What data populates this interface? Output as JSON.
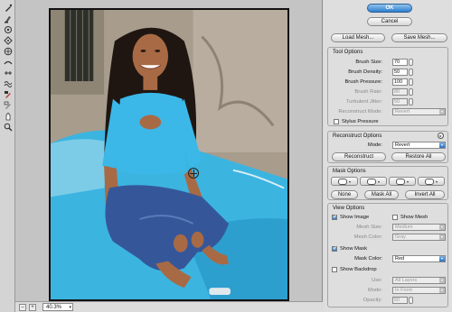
{
  "tools": [
    {
      "name": "forward-warp-icon"
    },
    {
      "name": "reconstruct-icon"
    },
    {
      "name": "twirl-clockwise-icon"
    },
    {
      "name": "pucker-icon"
    },
    {
      "name": "bloat-icon"
    },
    {
      "name": "push-left-icon"
    },
    {
      "name": "mirror-icon"
    },
    {
      "name": "turbulence-icon"
    },
    {
      "name": "freeze-mask-icon"
    },
    {
      "name": "thaw-mask-icon"
    },
    {
      "name": "hand-icon"
    },
    {
      "name": "zoom-icon"
    }
  ],
  "status": {
    "zoom_minus": "–",
    "zoom_plus": "+",
    "zoom": "40.3%"
  },
  "dialog": {
    "ok": "OK",
    "cancel": "Cancel",
    "load_mesh": "Load Mesh...",
    "save_mesh": "Save Mesh..."
  },
  "tool_options": {
    "title": "Tool Options",
    "brush_size": {
      "label": "Brush Size:",
      "value": "70"
    },
    "brush_density": {
      "label": "Brush Density:",
      "value": "50"
    },
    "brush_pressure": {
      "label": "Brush Pressure:",
      "value": "100"
    },
    "brush_rate": {
      "label": "Brush Rate:",
      "value": "80"
    },
    "turbulent_jitter": {
      "label": "Turbulent Jitter:",
      "value": "50"
    },
    "reconstruct_mode": {
      "label": "Reconstruct Mode:",
      "value": "Revert"
    },
    "stylus_pressure": "Stylus Pressure"
  },
  "reconstruct_options": {
    "title": "Reconstruct Options",
    "mode_label": "Mode:",
    "mode_value": "Revert",
    "reconstruct": "Reconstruct",
    "restore_all": "Restore All"
  },
  "mask_options": {
    "title": "Mask Options",
    "none": "None",
    "mask_all": "Mask All",
    "invert_all": "Invert All"
  },
  "view_options": {
    "title": "View Options",
    "show_image": "Show Image",
    "show_mesh": "Show Mesh",
    "mesh_size_label": "Mesh Size:",
    "mesh_size_value": "Medium",
    "mesh_color_label": "Mesh Color:",
    "mesh_color_value": "Gray",
    "show_mask": "Show Mask",
    "mask_color_label": "Mask Color:",
    "mask_color_value": "Red",
    "show_backdrop": "Show Backdrop",
    "use_label": "Use:",
    "use_value": "All Layers",
    "mode_label": "Mode:",
    "mode_value": "In Front",
    "opacity_label": "Opacity:",
    "opacity_value": "50"
  },
  "colors": {
    "accent": "#2e7fd0",
    "panel_bg": "#dedede",
    "car_blue": "#3cb4e0"
  }
}
